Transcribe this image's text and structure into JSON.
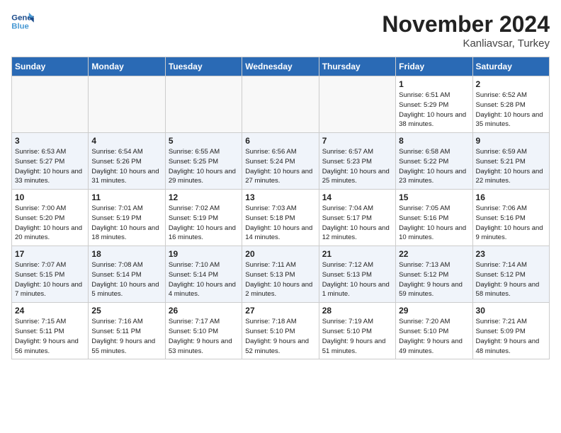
{
  "header": {
    "logo_line1": "General",
    "logo_line2": "Blue",
    "month_title": "November 2024",
    "location": "Kanliavsar, Turkey"
  },
  "weekdays": [
    "Sunday",
    "Monday",
    "Tuesday",
    "Wednesday",
    "Thursday",
    "Friday",
    "Saturday"
  ],
  "weeks": [
    [
      {
        "day": "",
        "empty": true
      },
      {
        "day": "",
        "empty": true
      },
      {
        "day": "",
        "empty": true
      },
      {
        "day": "",
        "empty": true
      },
      {
        "day": "",
        "empty": true
      },
      {
        "day": "1",
        "info": "Sunrise: 6:51 AM\nSunset: 5:29 PM\nDaylight: 10 hours and 38 minutes."
      },
      {
        "day": "2",
        "info": "Sunrise: 6:52 AM\nSunset: 5:28 PM\nDaylight: 10 hours and 35 minutes."
      }
    ],
    [
      {
        "day": "3",
        "info": "Sunrise: 6:53 AM\nSunset: 5:27 PM\nDaylight: 10 hours and 33 minutes."
      },
      {
        "day": "4",
        "info": "Sunrise: 6:54 AM\nSunset: 5:26 PM\nDaylight: 10 hours and 31 minutes."
      },
      {
        "day": "5",
        "info": "Sunrise: 6:55 AM\nSunset: 5:25 PM\nDaylight: 10 hours and 29 minutes."
      },
      {
        "day": "6",
        "info": "Sunrise: 6:56 AM\nSunset: 5:24 PM\nDaylight: 10 hours and 27 minutes."
      },
      {
        "day": "7",
        "info": "Sunrise: 6:57 AM\nSunset: 5:23 PM\nDaylight: 10 hours and 25 minutes."
      },
      {
        "day": "8",
        "info": "Sunrise: 6:58 AM\nSunset: 5:22 PM\nDaylight: 10 hours and 23 minutes."
      },
      {
        "day": "9",
        "info": "Sunrise: 6:59 AM\nSunset: 5:21 PM\nDaylight: 10 hours and 22 minutes."
      }
    ],
    [
      {
        "day": "10",
        "info": "Sunrise: 7:00 AM\nSunset: 5:20 PM\nDaylight: 10 hours and 20 minutes."
      },
      {
        "day": "11",
        "info": "Sunrise: 7:01 AM\nSunset: 5:19 PM\nDaylight: 10 hours and 18 minutes."
      },
      {
        "day": "12",
        "info": "Sunrise: 7:02 AM\nSunset: 5:19 PM\nDaylight: 10 hours and 16 minutes."
      },
      {
        "day": "13",
        "info": "Sunrise: 7:03 AM\nSunset: 5:18 PM\nDaylight: 10 hours and 14 minutes."
      },
      {
        "day": "14",
        "info": "Sunrise: 7:04 AM\nSunset: 5:17 PM\nDaylight: 10 hours and 12 minutes."
      },
      {
        "day": "15",
        "info": "Sunrise: 7:05 AM\nSunset: 5:16 PM\nDaylight: 10 hours and 10 minutes."
      },
      {
        "day": "16",
        "info": "Sunrise: 7:06 AM\nSunset: 5:16 PM\nDaylight: 10 hours and 9 minutes."
      }
    ],
    [
      {
        "day": "17",
        "info": "Sunrise: 7:07 AM\nSunset: 5:15 PM\nDaylight: 10 hours and 7 minutes."
      },
      {
        "day": "18",
        "info": "Sunrise: 7:08 AM\nSunset: 5:14 PM\nDaylight: 10 hours and 5 minutes."
      },
      {
        "day": "19",
        "info": "Sunrise: 7:10 AM\nSunset: 5:14 PM\nDaylight: 10 hours and 4 minutes."
      },
      {
        "day": "20",
        "info": "Sunrise: 7:11 AM\nSunset: 5:13 PM\nDaylight: 10 hours and 2 minutes."
      },
      {
        "day": "21",
        "info": "Sunrise: 7:12 AM\nSunset: 5:13 PM\nDaylight: 10 hours and 1 minute."
      },
      {
        "day": "22",
        "info": "Sunrise: 7:13 AM\nSunset: 5:12 PM\nDaylight: 9 hours and 59 minutes."
      },
      {
        "day": "23",
        "info": "Sunrise: 7:14 AM\nSunset: 5:12 PM\nDaylight: 9 hours and 58 minutes."
      }
    ],
    [
      {
        "day": "24",
        "info": "Sunrise: 7:15 AM\nSunset: 5:11 PM\nDaylight: 9 hours and 56 minutes."
      },
      {
        "day": "25",
        "info": "Sunrise: 7:16 AM\nSunset: 5:11 PM\nDaylight: 9 hours and 55 minutes."
      },
      {
        "day": "26",
        "info": "Sunrise: 7:17 AM\nSunset: 5:10 PM\nDaylight: 9 hours and 53 minutes."
      },
      {
        "day": "27",
        "info": "Sunrise: 7:18 AM\nSunset: 5:10 PM\nDaylight: 9 hours and 52 minutes."
      },
      {
        "day": "28",
        "info": "Sunrise: 7:19 AM\nSunset: 5:10 PM\nDaylight: 9 hours and 51 minutes."
      },
      {
        "day": "29",
        "info": "Sunrise: 7:20 AM\nSunset: 5:10 PM\nDaylight: 9 hours and 49 minutes."
      },
      {
        "day": "30",
        "info": "Sunrise: 7:21 AM\nSunset: 5:09 PM\nDaylight: 9 hours and 48 minutes."
      }
    ]
  ]
}
